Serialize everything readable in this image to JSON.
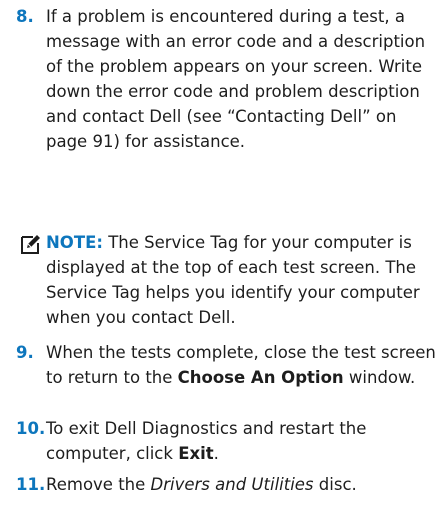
{
  "step8": {
    "number": "8.",
    "text": "If a problem is encountered during a test, a message with an error code and a description of the problem appears on your screen. Write down the error code and problem description and contact Dell (see “Contacting Dell” on page 91) for assistance."
  },
  "note": {
    "icon": "pencil-note-icon",
    "label": "NOTE:",
    "text": " The Service Tag for your computer is displayed at the top of each test screen. The Service Tag helps you identify your computer when you contact Dell."
  },
  "step9": {
    "number": "9.",
    "text_before": "When the tests complete, close the test screen to return to the ",
    "bold": "Choose An Option",
    "text_after": " window."
  },
  "step10": {
    "number": "10.",
    "text_before": "To exit Dell Diagnostics and restart the computer, click ",
    "bold": "Exit",
    "text_after": "."
  },
  "step11": {
    "number": "11.",
    "text_before": "Remove the ",
    "italic": "Drivers and Utilities",
    "text_after": " disc."
  },
  "colors": {
    "accent": "#0d76bd",
    "text": "#1d1d1d"
  }
}
